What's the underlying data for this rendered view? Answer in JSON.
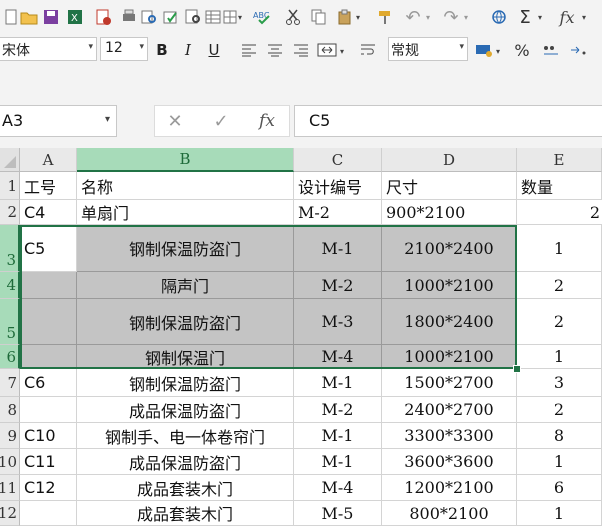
{
  "toolbar": {
    "font_name": "宋体",
    "font_size": "12",
    "bold": "B",
    "italic": "I",
    "underline": "U",
    "number_format": "常规",
    "percent": "%",
    "sum_symbol": "Σ",
    "fx_symbol": "fx"
  },
  "formula_bar": {
    "name_box": "A3",
    "fx": "fx",
    "content": "C5"
  },
  "columns": [
    "A",
    "B",
    "C",
    "D",
    "E"
  ],
  "rows": [
    "1",
    "2",
    "3",
    "4",
    "5",
    "6",
    "7",
    "8",
    "9",
    "10",
    "11",
    "12"
  ],
  "cells": {
    "r1": {
      "a": "工号",
      "b": "名称",
      "c": "设计编号",
      "d": "尺寸",
      "e": "数量"
    },
    "r2": {
      "a": "C4",
      "b": "单扇门",
      "c": "M-2",
      "d": "900*2100",
      "e": "2"
    },
    "r3": {
      "a": "C5",
      "b": "钢制保温防盗门",
      "c": "M-1",
      "d": "2100*2400",
      "e": "1"
    },
    "r4": {
      "a": "",
      "b": "隔声门",
      "c": "M-2",
      "d": "1000*2100",
      "e": "2"
    },
    "r5": {
      "a": "",
      "b": "钢制保温防盗门",
      "c": "M-3",
      "d": "1800*2400",
      "e": "2"
    },
    "r6": {
      "a": "",
      "b": "钢制保温门",
      "c": "M-4",
      "d": "1000*2100",
      "e": "1"
    },
    "r7": {
      "a": "C6",
      "b": "钢制保温防盗门",
      "c": "M-1",
      "d": "1500*2700",
      "e": "3"
    },
    "r8": {
      "a": "",
      "b": "成品保温防盗门",
      "c": "M-2",
      "d": "2400*2700",
      "e": "2"
    },
    "r9": {
      "a": "C10",
      "b": "钢制手、电一体卷帘门",
      "c": "M-1",
      "d": "3300*3300",
      "e": "8"
    },
    "r10": {
      "a": "C11",
      "b": "成品保温防盗门",
      "c": "M-1",
      "d": "3600*3600",
      "e": "1"
    },
    "r11": {
      "a": "C12",
      "b": "成品套装木门",
      "c": "M-4",
      "d": "1200*2100",
      "e": "6"
    },
    "r12": {
      "a": "",
      "b": "成品套装木门",
      "c": "M-5",
      "d": "800*2100",
      "e": "1"
    }
  },
  "colors": {
    "accent": "#217346",
    "selected_header": "#a7dbb9",
    "shaded_fill": "#c4c4c4"
  }
}
